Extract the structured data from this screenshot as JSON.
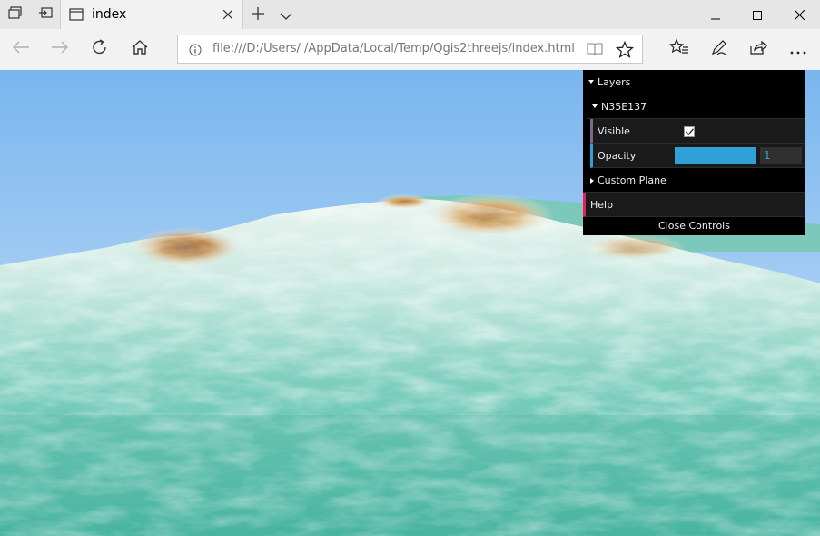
{
  "browser": {
    "tab": {
      "title": "index"
    },
    "address": {
      "url": "file:///D:/Users/           /AppData/Local/Temp/Qgis2threejs/index.html"
    }
  },
  "icons": {
    "set_aside_tabs": "tabs-aside-icon",
    "show_aside_tabs": "tabs-restore-icon",
    "tab_page": "page-icon",
    "new_tab": "plus-icon",
    "tab_list": "chevron-down-icon",
    "back": "arrow-left-icon",
    "forward": "arrow-right-icon",
    "refresh": "refresh-icon",
    "home": "home-icon",
    "info": "info-icon",
    "reading_view": "book-icon",
    "favorite": "star-icon",
    "favorites_hub": "star-list-icon",
    "notes": "pen-icon",
    "share": "share-icon",
    "more": "ellipsis-icon"
  },
  "gui": {
    "layers_label": "Layers",
    "layer_name": "N35E137",
    "visible_label": "Visible",
    "visible_checked": true,
    "opacity_label": "Opacity",
    "opacity_value": "1",
    "opacity_fraction": 1.0,
    "custom_plane_label": "Custom Plane",
    "help_label": "Help",
    "close_label": "Close Controls"
  },
  "colors": {
    "accent_blue": "#2fa1d6",
    "help_pink": "#e61d5f",
    "folder_purple": "#806787",
    "sky_top": "#79b6ee",
    "sky_bottom": "#d3e6f8",
    "terrain_teal": "#5cc0ac",
    "terrain_brown": "#b67c3c"
  }
}
